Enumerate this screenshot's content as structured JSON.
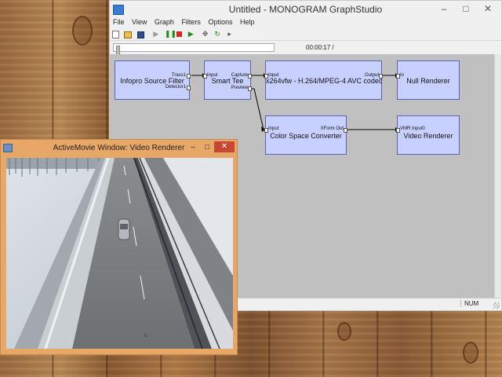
{
  "graphstudio": {
    "title": "Untitled - MONOGRAM GraphStudio",
    "window_buttons": {
      "minimize": "–",
      "maximize": "□",
      "close": "✕"
    },
    "menu": [
      "File",
      "View",
      "Graph",
      "Filters",
      "Options",
      "Help"
    ],
    "toolbar_icons": [
      "new-icon",
      "open-icon",
      "save-icon",
      "play-icon",
      "pause-icon",
      "stop-icon",
      "step-icon",
      "seek-icon",
      "refresh-icon",
      "frame-step-icon"
    ],
    "timecode": "00:00:17 /",
    "status_num": "NUM"
  },
  "filters": {
    "infopro": {
      "name": "Infopro Source Filter",
      "pins": {
        "trass": "Trass1",
        "detector": "Detector1"
      }
    },
    "smart_tee": {
      "name": "Smart Tee",
      "pins": {
        "input": "Input",
        "capture": "Capture",
        "preview": "Preview"
      }
    },
    "x264": {
      "name": "x264vfw - H.264/MPEG-4 AVC codec",
      "pins": {
        "input": "Input",
        "output": "Output"
      }
    },
    "null_renderer": {
      "name": "Null Renderer",
      "pins": {
        "in": "In"
      }
    },
    "color_space": {
      "name": "Color Space Converter",
      "pins": {
        "input": "Input",
        "xform_out": "XForm Out"
      }
    },
    "video_renderer": {
      "name": "Video Renderer",
      "pins": {
        "vmr_input": "VMR Input0"
      }
    }
  },
  "video_window": {
    "title": "ActiveMovie Window: Video Renderer",
    "buttons": {
      "minimize": "–",
      "maximize": "□",
      "close": "✕"
    }
  },
  "colors": {
    "filter_fill": "#c8d0ff",
    "filter_border": "#5a62b8",
    "canvas": "#c0c0c0",
    "video_frame": "#e7a766",
    "close_button": "#c74636"
  }
}
